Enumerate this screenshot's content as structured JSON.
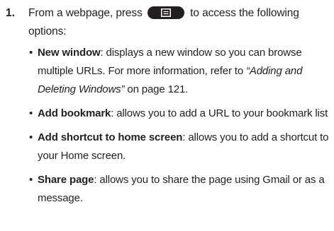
{
  "step": {
    "number": "1.",
    "text_before_key": "From a webpage, press",
    "key_icon": "menu-key-icon",
    "text_after_key": "to access the following options:"
  },
  "bullets": [
    {
      "term": "New window",
      "text": ": displays a new window so you can browse multiple URLs. For more information, refer to ",
      "xref": "“Adding and Deleting Windows”",
      "suffix": " on page 121."
    },
    {
      "term": "Add bookmark",
      "text": ": allows you to add a URL to your bookmark list"
    },
    {
      "term": "Add shortcut to home screen",
      "text": ": allows you to add a shortcut to your Home screen."
    },
    {
      "term": "Share page",
      "text": ": allows you to share the page using Gmail or as a message."
    }
  ],
  "colors": {
    "text": "#231f20",
    "key_background": "#231f20",
    "key_glyph": "#ffffff"
  }
}
